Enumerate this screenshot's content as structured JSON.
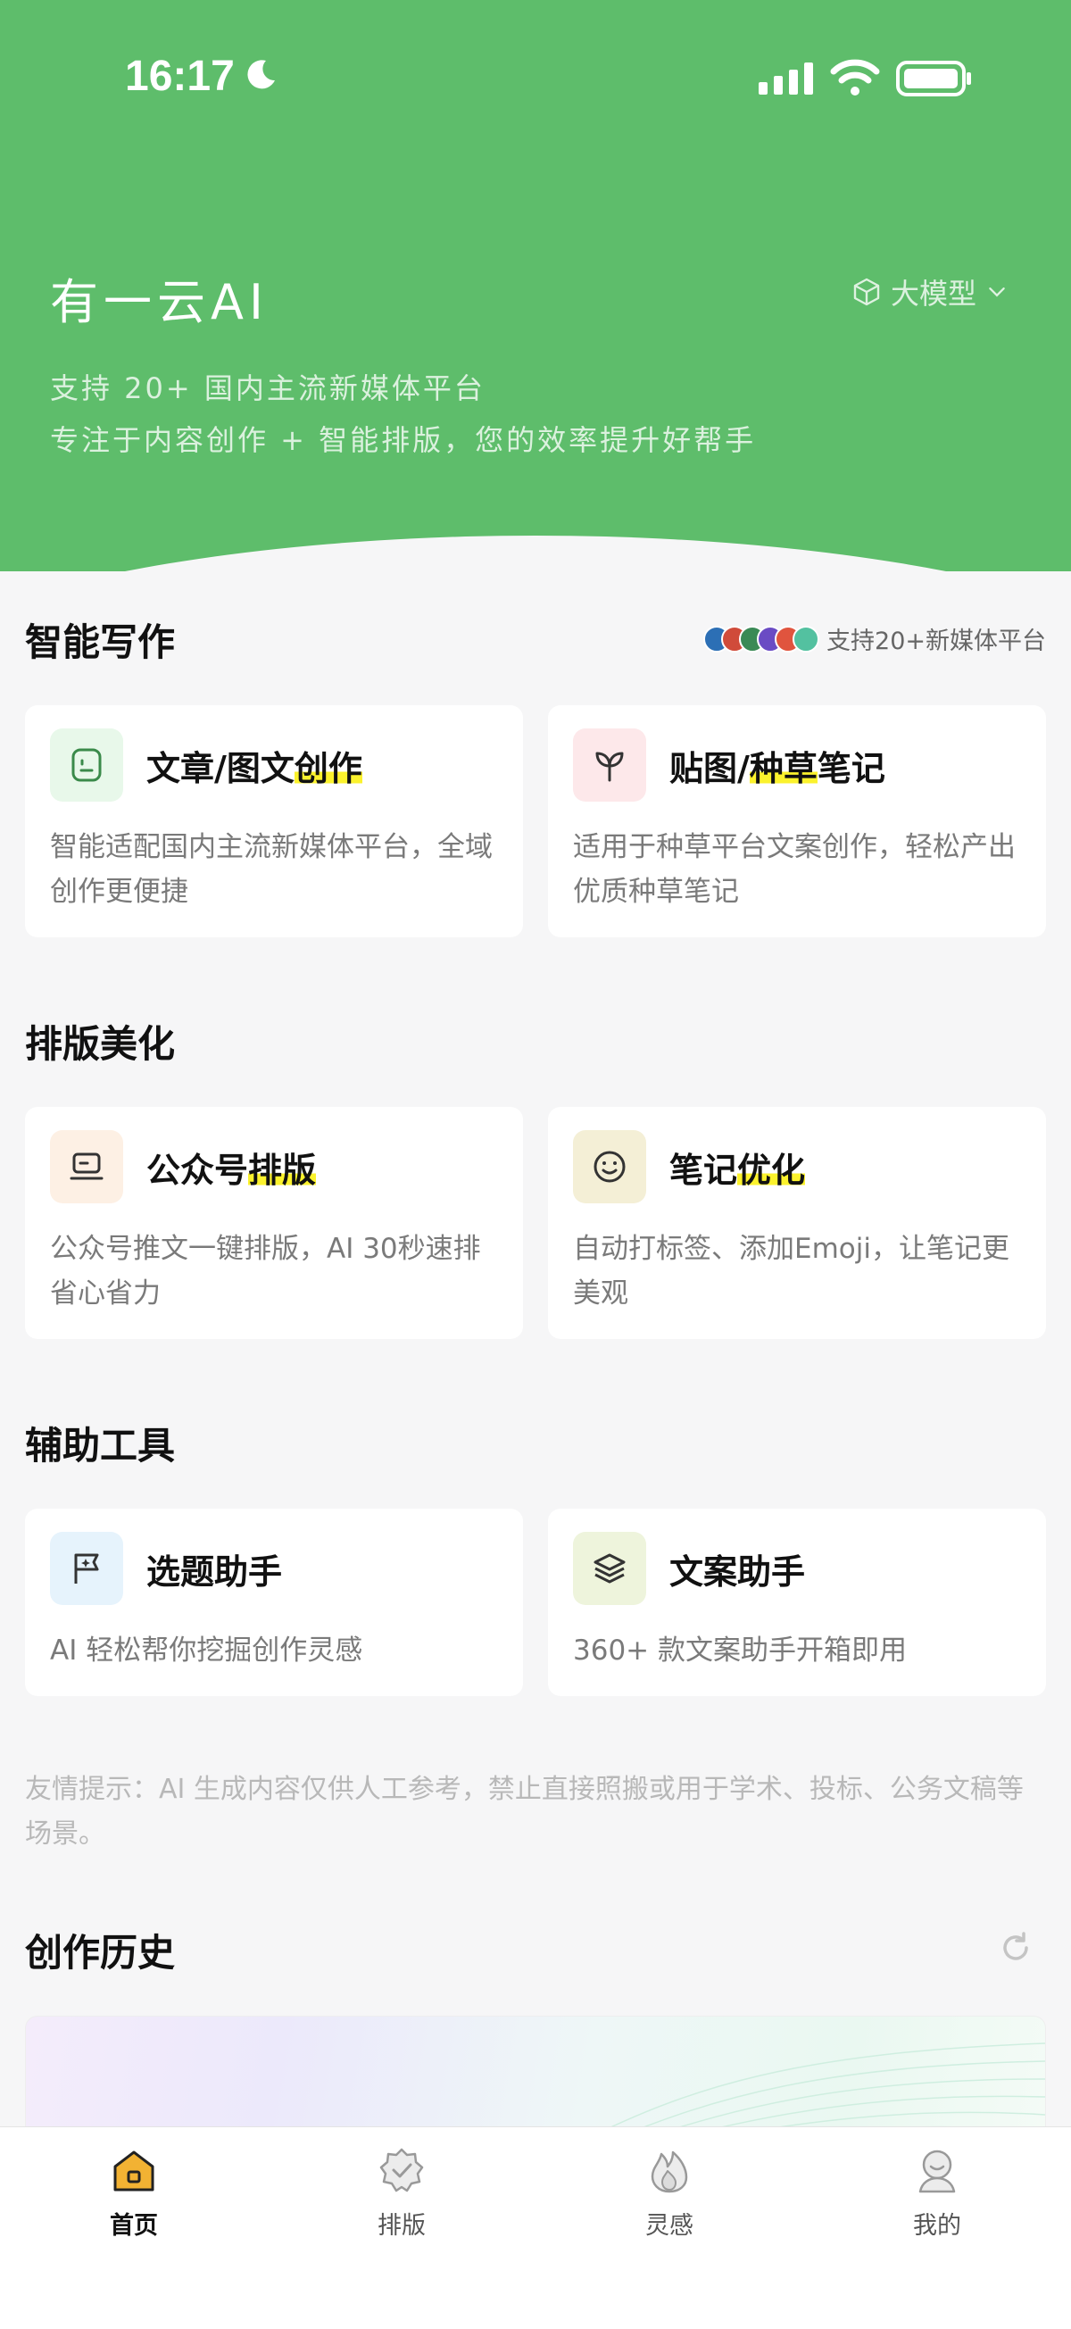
{
  "status_bar": {
    "time": "16:17"
  },
  "header": {
    "title": "有一云AI",
    "model_button": "大模型",
    "subtitle_line1": "支持 20+ 国内主流新媒体平台",
    "subtitle_line2": "专注于内容创作 + 智能排版，您的效率提升好帮手"
  },
  "sections": {
    "writing": {
      "title": "智能写作",
      "platform_note": "支持20+新媒体平台",
      "cards": [
        {
          "title_plain": "文章/图文",
          "title_highlight": "创作",
          "title_suffix": "",
          "icon": "document-face-icon",
          "icon_bg": "#e8f8ea",
          "desc": "智能适配国内主流新媒体平台，全域创作更便捷"
        },
        {
          "title_plain": "贴图/",
          "title_highlight": "种草",
          "title_suffix": "笔记",
          "icon": "sprout-icon",
          "icon_bg": "#fde8ea",
          "desc": "适用于种草平台文案创作，轻松产出优质种草笔记"
        }
      ]
    },
    "layout": {
      "title": "排版美化",
      "cards": [
        {
          "title_plain": "公众号",
          "title_highlight": "排版",
          "title_suffix": "",
          "icon": "laptop-icon",
          "icon_bg": "#fdf0e4",
          "desc": "公众号推文一键排版，AI 30秒速排省心省力"
        },
        {
          "title_plain": "笔记",
          "title_highlight": "优化",
          "title_suffix": "",
          "icon": "smile-icon",
          "icon_bg": "#f4efd6",
          "desc": "自动打标签、添加Emoji，让笔记更美观"
        }
      ]
    },
    "tools": {
      "title": "辅助工具",
      "cards": [
        {
          "title": "选题助手",
          "icon": "flag-sparkle-icon",
          "icon_bg": "#e6f3fc",
          "desc": "AI 轻松帮你挖掘创作灵感"
        },
        {
          "title": "文案助手",
          "icon": "layers-icon",
          "icon_bg": "#eef4dc",
          "desc": "360+ 款文案助手开箱即用"
        }
      ]
    },
    "tip": "友情提示：AI 生成内容仅供人工参考，禁止直接照搬或用于学术、投标、公务文稿等场景。",
    "history": {
      "title": "创作历史"
    }
  },
  "tabbar": {
    "items": [
      {
        "label": "首页",
        "icon": "home-icon",
        "active": true
      },
      {
        "label": "排版",
        "icon": "badge-check-icon",
        "active": false
      },
      {
        "label": "灵感",
        "icon": "flame-icon",
        "active": false
      },
      {
        "label": "我的",
        "icon": "profile-icon",
        "active": false
      }
    ]
  },
  "colors": {
    "brand_green": "#5ebd6b",
    "highlight": "#fbf22d",
    "home_icon": "#f2b233"
  }
}
